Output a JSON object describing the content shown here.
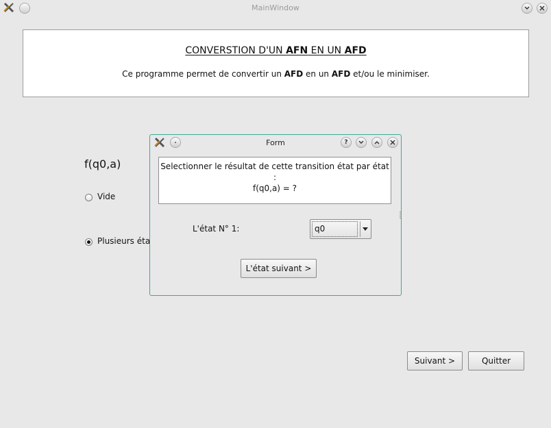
{
  "window": {
    "title": "MainWindow"
  },
  "header": {
    "title_part1": "CONVERSTION D'UN ",
    "title_afn": "AFN",
    "title_part2": " EN UN ",
    "title_afd": "AFD",
    "desc_part1": "Ce programme permet de convertir un ",
    "desc_afd1": "AFD",
    "desc_part2": " en un ",
    "desc_afd2": "AFD",
    "desc_part3": " et/ou le minimiser."
  },
  "question": {
    "label": "f(q0,a)",
    "options": [
      {
        "label": "Vide",
        "checked": false
      },
      {
        "label": "Plusieurs état",
        "checked": true
      }
    ]
  },
  "buttons": {
    "next": "Suivant >",
    "quit": "Quitter"
  },
  "dialog": {
    "title": "Form",
    "message_line1": "Selectionner le résultat de cette transition état par état :",
    "message_line2": "f(q0,a) = ?",
    "state_label": "L'état N° 1:",
    "state_value": "q0",
    "next_state_button": "L'état suivant >"
  },
  "icons": {
    "app": "app-x-icon",
    "minimize": "minimize-icon",
    "help": "help-icon",
    "chevron_down": "chevron-down-icon",
    "chevron_up": "chevron-up-icon",
    "close": "close-icon"
  },
  "colors": {
    "dialog_border": "#3fa896",
    "window_bg": "#e8e8e8"
  }
}
